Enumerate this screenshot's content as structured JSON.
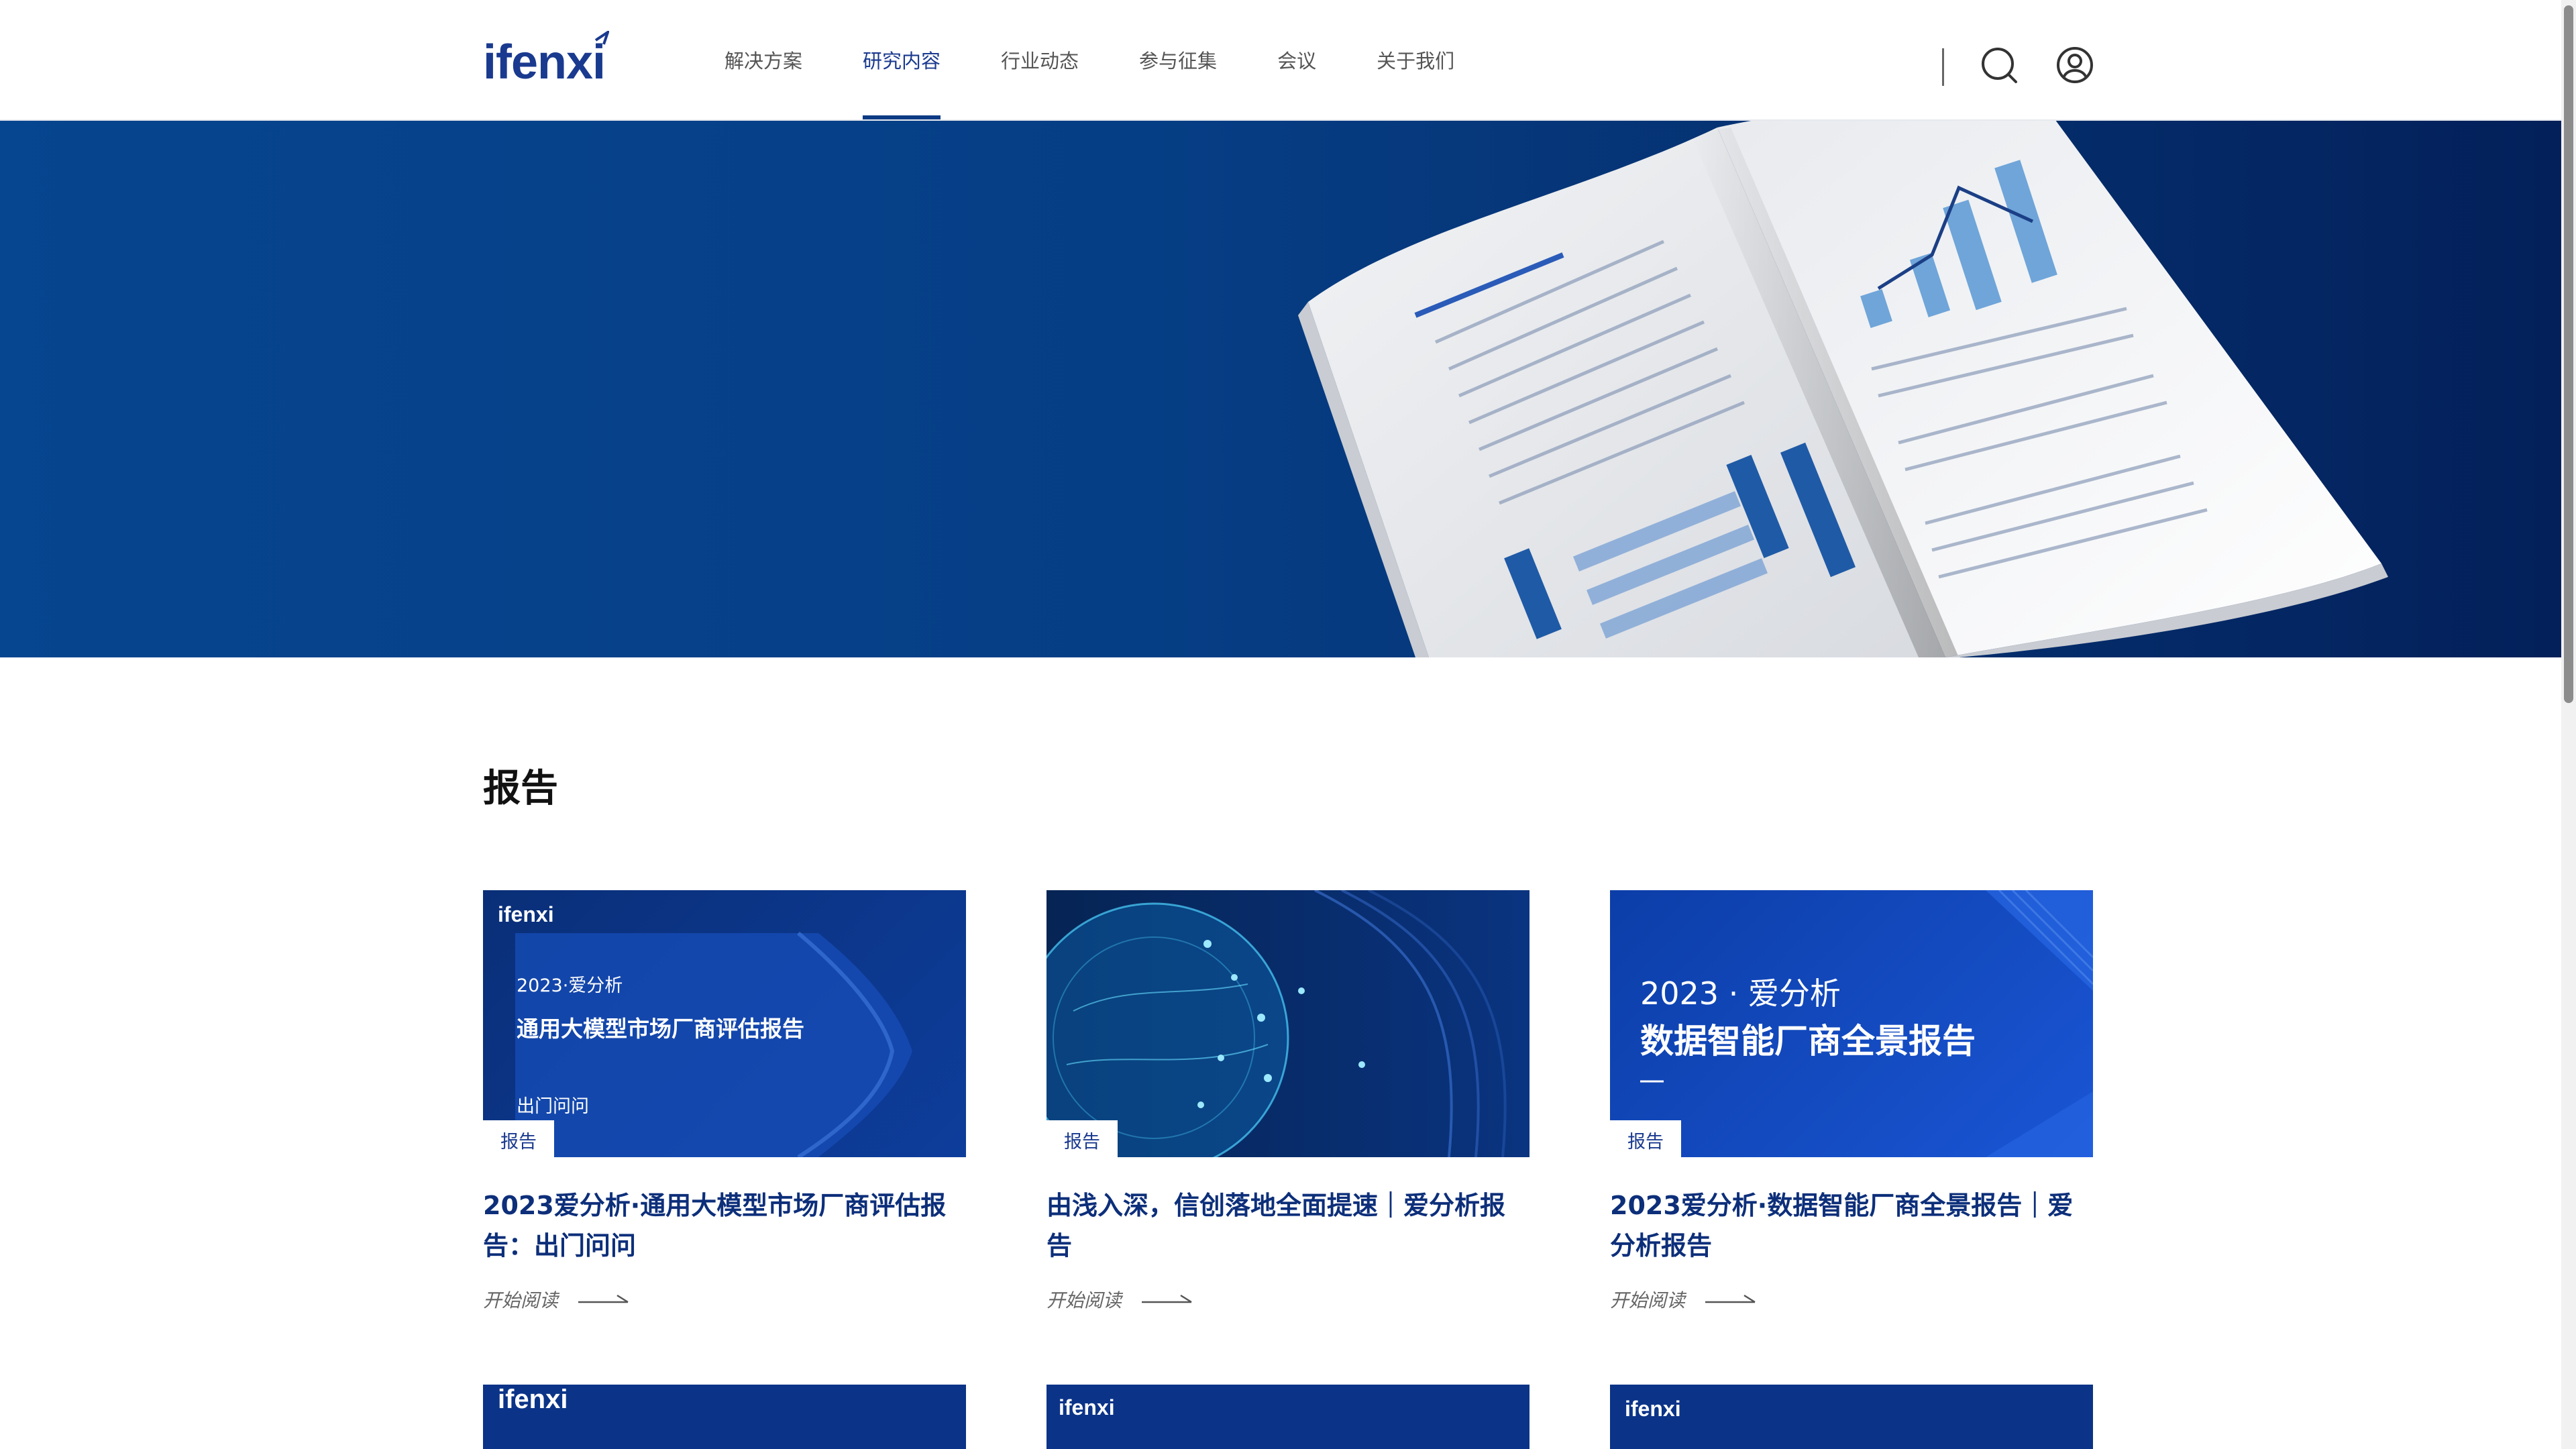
{
  "header": {
    "logo": "ifenxi",
    "nav": [
      "解决方案",
      "研究内容",
      "行业动态",
      "参与征集",
      "会议",
      "关于我们"
    ],
    "active_nav": "研究内容",
    "icons": [
      "search-icon",
      "user-icon"
    ]
  },
  "section": {
    "title": "报告"
  },
  "cards": [
    {
      "thumb_logo": "ifenxi",
      "thumb_year": "2023·爱分析",
      "thumb_title": "通用大模型市场厂商评估报告",
      "thumb_sub": "出门问问",
      "tag": "报告",
      "title": "2023爱分析·通用大模型市场厂商评估报告：出门问问",
      "read_more": "开始阅读"
    },
    {
      "tag": "报告",
      "title": "由浅入深，信创落地全面提速｜爱分析报告",
      "read_more": "开始阅读"
    },
    {
      "thumb_year": "2023 · 爱分析",
      "thumb_title": "数据智能厂商全景报告",
      "tag": "报告",
      "title": "2023爱分析·数据智能厂商全景报告｜爱分析报告",
      "read_more": "开始阅读"
    }
  ],
  "next_row_logos": [
    "ifenxi",
    "ifenxi",
    "ifenxi"
  ],
  "colors": {
    "brand": "#1a3a8f",
    "hero": "#063e85"
  }
}
